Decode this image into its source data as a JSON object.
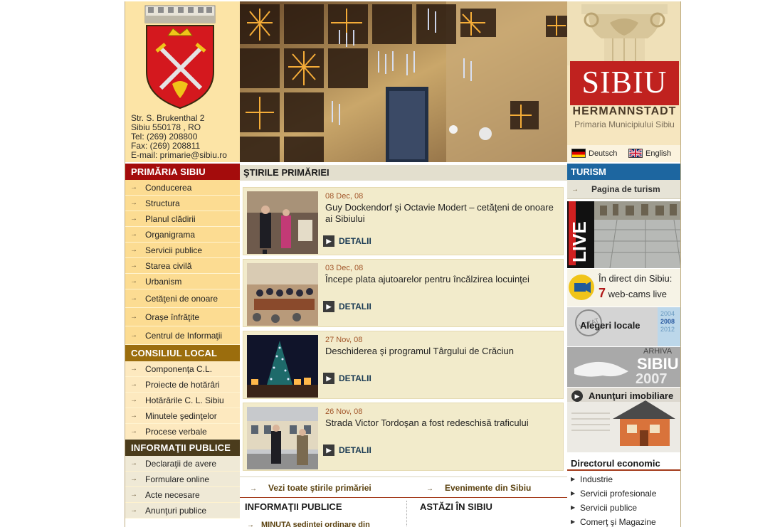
{
  "header": {
    "address_lines": [
      "Str. S. Brukenthal 2",
      "Sibiu 550178 , RO",
      "Tel: (269) 208800",
      "Fax: (269) 208811",
      "E-mail: primarie@sibiu.ro"
    ],
    "brand": "SIBIU",
    "subbrand": "HERMANNSTADT",
    "municipality": "Primaria Municipiului Sibiu",
    "lang_de": "Deutsch",
    "lang_en": "English"
  },
  "leftnav": {
    "section1": {
      "title": "PRIMĂRIA SIBIU",
      "items": [
        "Conducerea",
        "Structura",
        "Planul clădirii",
        "Organigrama",
        "Servicii publice",
        "Starea civilă",
        "Urbanism",
        "Cetăţeni de onoare",
        "Oraşe înfrăţite",
        "Centrul de Informaţii"
      ]
    },
    "section2": {
      "title": "CONSILIUL LOCAL",
      "items": [
        "Componenţa C.L.",
        "Proiecte de hotărâri",
        "Hotărârile C. L. Sibiu",
        "Minutele şedinţelor",
        "Procese verbale"
      ]
    },
    "section3": {
      "title": "INFORMAŢII PUBLICE",
      "items": [
        "Declaraţii de avere",
        "Formulare online",
        "Acte necesare",
        "Anunţuri publice"
      ]
    }
  },
  "center": {
    "title": "ŞTIRILE PRIMĂRIEI",
    "news": [
      {
        "date": "08 Dec, 08",
        "title": "Guy Dockendorf şi Octavie Modert – cetăţeni de onoare ai Sibiului",
        "link": "DETALII"
      },
      {
        "date": "03 Dec, 08",
        "title": "Începe plata ajutoarelor pentru încălzirea locuinţei",
        "link": "DETALII"
      },
      {
        "date": "27 Nov, 08",
        "title": "Deschiderea şi programul Târgului de Crăciun",
        "link": "DETALII"
      },
      {
        "date": "26 Nov, 08",
        "title": "Strada Victor Tordoşan a fost redeschisă traficului",
        "link": "DETALII"
      }
    ],
    "more_news": "Vezi toate ştirile primăriei",
    "events": "Evenimente din Sibiu",
    "info_publice": "INFORMAŢII PUBLICE",
    "astazi": "ASTĂZI ÎN SIBIU",
    "minuta": "MINUTA ședinței ordinare din"
  },
  "right": {
    "turism_title": "TURISM",
    "turism_link": "Pagina de turism",
    "live_label": "LIVE",
    "webcam_line1": "În direct din Sibiu:",
    "webcam_count": "7",
    "webcam_line2": "web-cams live",
    "alegeri": "Alegeri locale",
    "alegeri_stamp": "VOTAT",
    "alegeri_years": [
      "2004",
      "2008",
      "2012"
    ],
    "arhiva_label": "ARHIVA",
    "arhiva_city": "SIBIU",
    "arhiva_year": "2007",
    "anunturi": "Anunţuri imobiliare",
    "dir_title": "Directorul economic",
    "dir_items": [
      "Industrie",
      "Servicii profesionale",
      "Servicii publice",
      "Comerţ şi Magazine"
    ]
  }
}
